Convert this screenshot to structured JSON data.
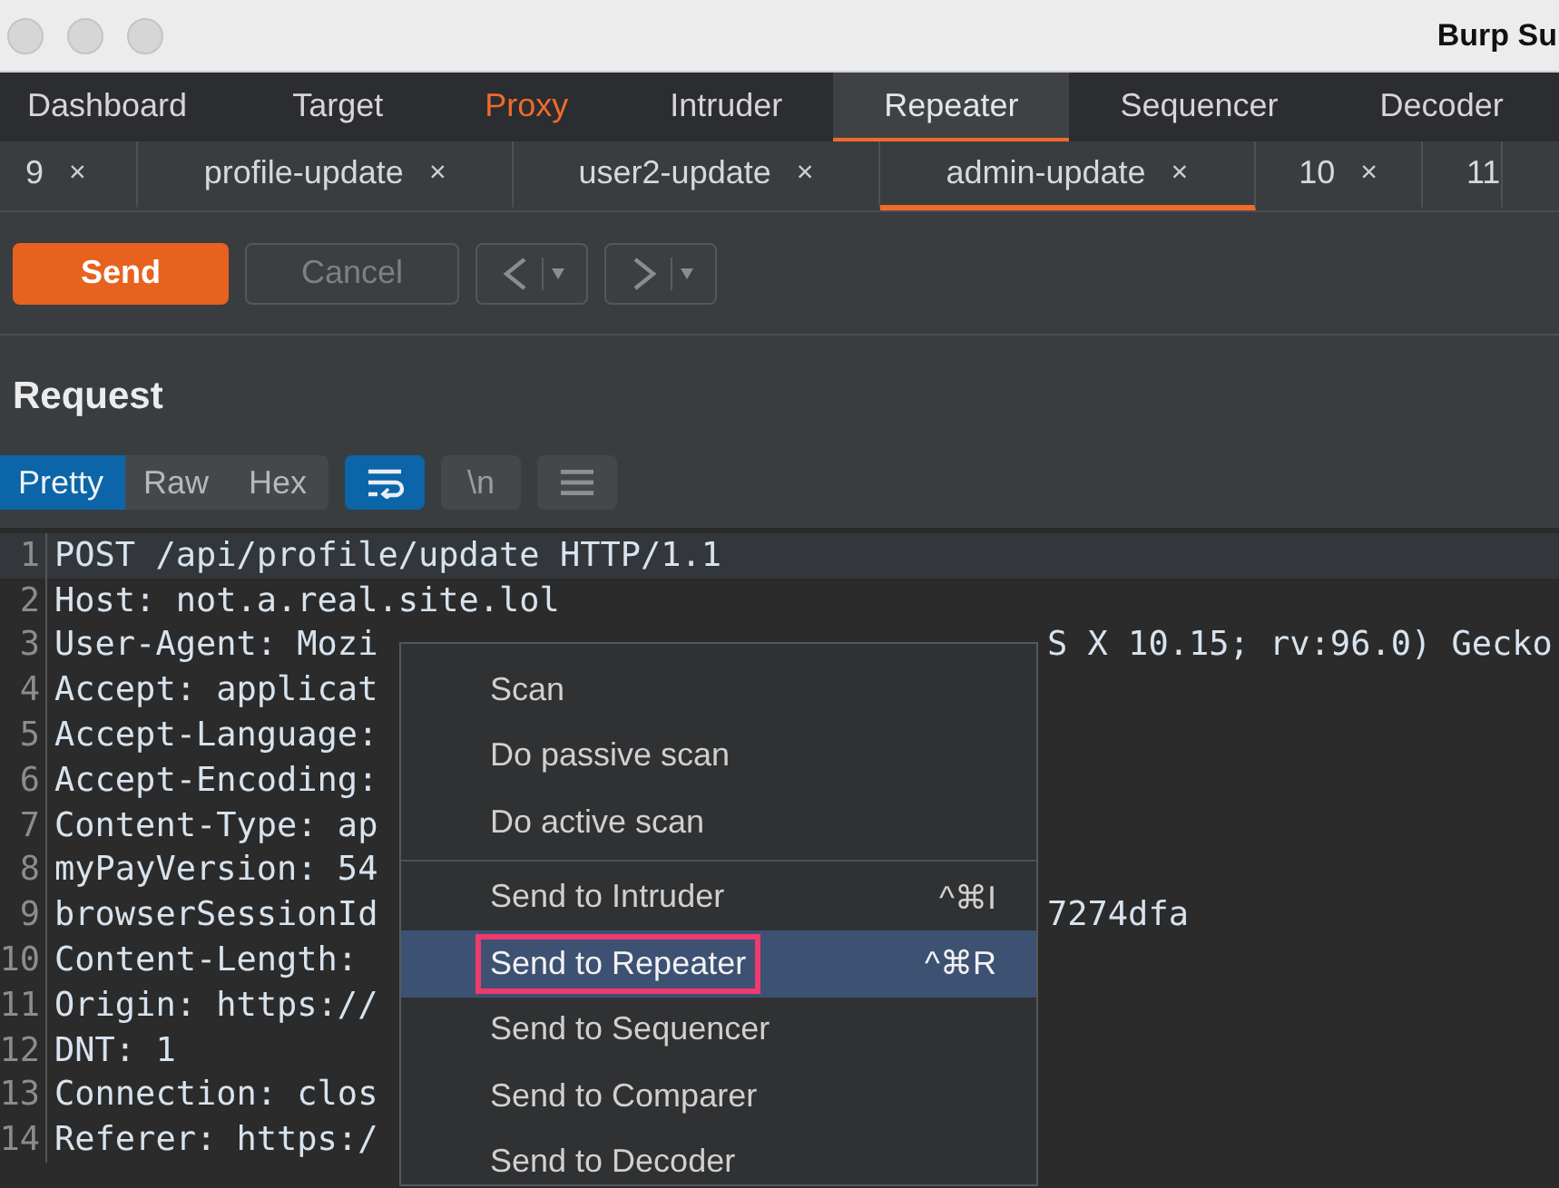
{
  "window": {
    "title": "Burp Su"
  },
  "main_tabs": [
    {
      "label": "Dashboard",
      "selected": false,
      "highlighted": false
    },
    {
      "label": "Target",
      "selected": false,
      "highlighted": false
    },
    {
      "label": "Proxy",
      "selected": false,
      "highlighted": true
    },
    {
      "label": "Intruder",
      "selected": false,
      "highlighted": false
    },
    {
      "label": "Repeater",
      "selected": true,
      "highlighted": false
    },
    {
      "label": "Sequencer",
      "selected": false,
      "highlighted": false
    },
    {
      "label": "Decoder",
      "selected": false,
      "highlighted": false
    }
  ],
  "repeater_tabs": [
    {
      "label": "9",
      "close": "×",
      "selected": false
    },
    {
      "label": "profile-update",
      "close": "×",
      "selected": false
    },
    {
      "label": "user2-update",
      "close": "×",
      "selected": false
    },
    {
      "label": "admin-update",
      "close": "×",
      "selected": true
    },
    {
      "label": "10",
      "close": "×",
      "selected": false
    },
    {
      "label": "11",
      "selected": false
    }
  ],
  "toolbar": {
    "send": "Send",
    "cancel": {
      "label": "Cancel",
      "disabled": true
    }
  },
  "request": {
    "title": "Request",
    "views": [
      {
        "label": "Pretty",
        "selected": true
      },
      {
        "label": "Raw",
        "selected": false
      },
      {
        "label": "Hex",
        "selected": false
      }
    ],
    "options": [
      {
        "kind": "wrap",
        "on": true
      },
      {
        "kind": "newline",
        "label": "\\n",
        "on": false
      },
      {
        "kind": "menu",
        "on": false
      }
    ],
    "lines": [
      {
        "number": "1",
        "text": "POST /api/profile/update HTTP/1.1",
        "current": true
      },
      {
        "number": "2",
        "text": "Host: not.a.real.site.lol",
        "current": false
      },
      {
        "number": "3",
        "text": "User-Agent: Mozi",
        "tail": "S X 10.15; rv:96.0) Gecko",
        "current": false
      },
      {
        "number": "4",
        "text": "Accept: applicat",
        "current": false
      },
      {
        "number": "5",
        "text": "Accept-Language:",
        "current": false
      },
      {
        "number": "6",
        "text": "Accept-Encoding:",
        "current": false
      },
      {
        "number": "7",
        "text": "Content-Type: ap",
        "current": false
      },
      {
        "number": "8",
        "text": "myPayVersion: 54",
        "current": false
      },
      {
        "number": "9",
        "text": "browserSessionId",
        "tail": "7274dfa",
        "current": false
      },
      {
        "number": "10",
        "text": "Content-Length:",
        "current": false
      },
      {
        "number": "11",
        "text": "Origin: https://",
        "current": false
      },
      {
        "number": "12",
        "text": "DNT: 1",
        "current": false
      },
      {
        "number": "13",
        "text": "Connection: clos",
        "current": false
      },
      {
        "number": "14",
        "text": "Referer: https:/",
        "current": false
      }
    ]
  },
  "context_menu": [
    {
      "kind": "item",
      "label": "Scan",
      "selected": false,
      "outlined": false
    },
    {
      "kind": "item",
      "label": "Do passive scan",
      "selected": false,
      "outlined": false
    },
    {
      "kind": "item",
      "label": "Do active scan",
      "selected": false,
      "outlined": false
    },
    {
      "kind": "separator"
    },
    {
      "kind": "item",
      "label": "Send to Intruder",
      "shortcut": "^⌘I",
      "selected": false,
      "outlined": false
    },
    {
      "kind": "item",
      "label": "Send to Repeater",
      "shortcut": "^⌘R",
      "selected": true,
      "outlined": true
    },
    {
      "kind": "item",
      "label": "Send to Sequencer",
      "selected": false,
      "outlined": false
    },
    {
      "kind": "item",
      "label": "Send to Comparer",
      "selected": false,
      "outlined": false
    },
    {
      "kind": "item",
      "label": "Send to Decoder",
      "selected": false,
      "outlined": false
    }
  ]
}
